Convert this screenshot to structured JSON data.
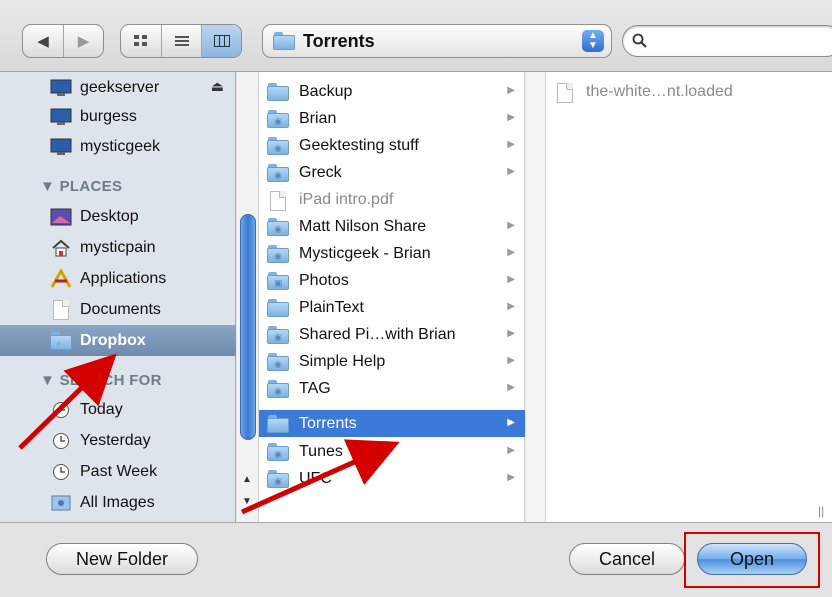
{
  "toolbar": {
    "back_icon": "back-arrow-icon",
    "forward_icon": "forward-arrow-icon",
    "view_modes": [
      "icon-view",
      "list-view",
      "column-view"
    ],
    "path_label": "Torrents"
  },
  "sidebar": {
    "devices": [
      {
        "label": "geekserver",
        "icon": "server-icon"
      },
      {
        "label": "burgess",
        "icon": "computer-icon"
      },
      {
        "label": "mysticgeek",
        "icon": "computer-icon"
      }
    ],
    "places_header": "▼ PLACES",
    "places": [
      {
        "label": "Desktop",
        "icon": "desktop-icon"
      },
      {
        "label": "mysticpain",
        "icon": "home-icon"
      },
      {
        "label": "Applications",
        "icon": "applications-icon"
      },
      {
        "label": "Documents",
        "icon": "documents-icon"
      },
      {
        "label": "Dropbox",
        "icon": "folder-icon",
        "selected": true
      }
    ],
    "search_header": "▼ SEARCH FOR",
    "search_for": [
      {
        "label": "Today",
        "icon": "clock-icon"
      },
      {
        "label": "Yesterday",
        "icon": "clock-icon"
      },
      {
        "label": "Past Week",
        "icon": "clock-icon"
      },
      {
        "label": "All Images",
        "icon": "images-icon"
      }
    ]
  },
  "dropbox_column": {
    "items": [
      {
        "label": "Backup",
        "type": "folder"
      },
      {
        "label": "Brian",
        "type": "shared-folder"
      },
      {
        "label": "Geektesting stuff",
        "type": "shared-folder"
      },
      {
        "label": "Greck",
        "type": "shared-folder"
      },
      {
        "label": "iPad intro.pdf",
        "type": "file"
      },
      {
        "label": "Matt Nilson Share",
        "type": "shared-folder"
      },
      {
        "label": "Mysticgeek - Brian",
        "type": "shared-folder"
      },
      {
        "label": "Photos",
        "type": "photos-folder"
      },
      {
        "label": "PlainText",
        "type": "folder"
      },
      {
        "label": "Shared Pi…with Brian",
        "type": "shared-folder"
      },
      {
        "label": "Simple Help",
        "type": "shared-folder"
      },
      {
        "label": "TAG",
        "type": "shared-folder"
      },
      {
        "label": "Torrents",
        "type": "folder",
        "selected": true
      },
      {
        "label": "Tunes",
        "type": "shared-folder"
      },
      {
        "label": "UFC",
        "type": "shared-folder"
      }
    ]
  },
  "torrents_column": {
    "items": [
      {
        "label": "the-white…nt.loaded",
        "type": "file"
      }
    ]
  },
  "buttons": {
    "new_folder": "New Folder",
    "cancel": "Cancel",
    "open": "Open"
  },
  "colors": {
    "selection": "#3b7ad8",
    "sidebar_bg": "#dde4eb",
    "annotation": "#d40000"
  }
}
